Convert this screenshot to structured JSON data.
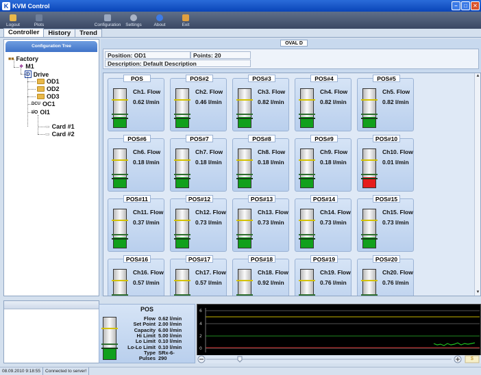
{
  "window": {
    "title": "KVM Control"
  },
  "toolbar": {
    "items": [
      "Logout",
      "Plots",
      "Configuration",
      "Settings",
      "About",
      "Exit"
    ]
  },
  "tabs": [
    "Controller",
    "History",
    "Trend"
  ],
  "config_tree": {
    "title": "Configuration Tree",
    "nodes": [
      {
        "label": "Factory",
        "icon": "factory-icon"
      },
      {
        "label": "M1",
        "icon": "machine-icon"
      },
      {
        "label": "Drive",
        "icon": "drive-icon"
      },
      {
        "label": "OD1",
        "icon": "folder-icon"
      },
      {
        "label": "OD2",
        "icon": "folder-icon"
      },
      {
        "label": "OD3",
        "icon": "folder-icon"
      },
      {
        "label": "OC1",
        "icon": "dcu-icon"
      },
      {
        "label": "OI1",
        "icon": "io-icon"
      },
      {
        "label": "Card #1",
        "icon": "card-icon"
      },
      {
        "label": "Card #2",
        "icon": "card-icon"
      }
    ]
  },
  "main": {
    "oval_title": "OVAL D",
    "position": "Position:  OD1",
    "points": "Points:  20",
    "description": "Description:  Default Description"
  },
  "sensors": [
    {
      "title": "POS",
      "name": "Ch1. Flow",
      "value": "0.62 l/min",
      "alarm": false
    },
    {
      "title": "POS#2",
      "name": "Ch2. Flow",
      "value": "0.46 l/min",
      "alarm": false
    },
    {
      "title": "POS#3",
      "name": "Ch3. Flow",
      "value": "0.82 l/min",
      "alarm": false
    },
    {
      "title": "POS#4",
      "name": "Ch4. Flow",
      "value": "0.82 l/min",
      "alarm": false
    },
    {
      "title": "POS#5",
      "name": "Ch5. Flow",
      "value": "0.82 l/min",
      "alarm": false
    },
    {
      "title": "POS#6",
      "name": "Ch6. Flow",
      "value": "0.18 l/min",
      "alarm": false
    },
    {
      "title": "POS#7",
      "name": "Ch7. Flow",
      "value": "0.18 l/min",
      "alarm": false
    },
    {
      "title": "POS#8",
      "name": "Ch8. Flow",
      "value": "0.18 l/min",
      "alarm": false
    },
    {
      "title": "POS#9",
      "name": "Ch9. Flow",
      "value": "0.18 l/min",
      "alarm": false
    },
    {
      "title": "POS#10",
      "name": "Ch10. Flow",
      "value": "0.01 l/min",
      "alarm": true
    },
    {
      "title": "POS#11",
      "name": "Ch11. Flow",
      "value": "0.37 l/min",
      "alarm": false
    },
    {
      "title": "POS#12",
      "name": "Ch12. Flow",
      "value": "0.73 l/min",
      "alarm": false
    },
    {
      "title": "POS#13",
      "name": "Ch13. Flow",
      "value": "0.73 l/min",
      "alarm": false
    },
    {
      "title": "POS#14",
      "name": "Ch14. Flow",
      "value": "0.73 l/min",
      "alarm": false
    },
    {
      "title": "POS#15",
      "name": "Ch15. Flow",
      "value": "0.73 l/min",
      "alarm": false
    },
    {
      "title": "POS#16",
      "name": "Ch16. Flow",
      "value": "0.57 l/min",
      "alarm": false
    },
    {
      "title": "POS#17",
      "name": "Ch17. Flow",
      "value": "0.57 l/min",
      "alarm": false
    },
    {
      "title": "POS#18",
      "name": "Ch18. Flow",
      "value": "0.92 l/min",
      "alarm": false
    },
    {
      "title": "POS#19",
      "name": "Ch19. Flow",
      "value": "0.76 l/min",
      "alarm": false
    },
    {
      "title": "POS#20",
      "name": "Ch20. Flow",
      "value": "0.76 l/min",
      "alarm": false
    }
  ],
  "detail": {
    "title": "POS",
    "rows": [
      {
        "key": "Flow",
        "value": "0.62 l/min"
      },
      {
        "key": "Set Point",
        "value": "2.00 l/min"
      },
      {
        "key": "Capacity",
        "value": "6.00 l/min"
      },
      {
        "key": "Hi Limit",
        "value": "5.00 l/min"
      },
      {
        "key": "Lo Limit",
        "value": "0.10 l/min"
      },
      {
        "key": "Lo-Lo Limit",
        "value": "0.10 l/min"
      },
      {
        "key": "Type",
        "value": "SRx-6-"
      },
      {
        "key": "Pulses",
        "value": "290"
      }
    ]
  },
  "trend": {
    "y_ticks": [
      "6",
      "4",
      "2",
      "0"
    ],
    "play_label": "$"
  },
  "status": {
    "timestamp": "08.09.2010 9:18:55",
    "connection": "Connected to server!"
  },
  "colors": {
    "ok_fill": "#11a01c",
    "alarm_fill": "#e51c1c",
    "limit_line": "#d4c200"
  }
}
